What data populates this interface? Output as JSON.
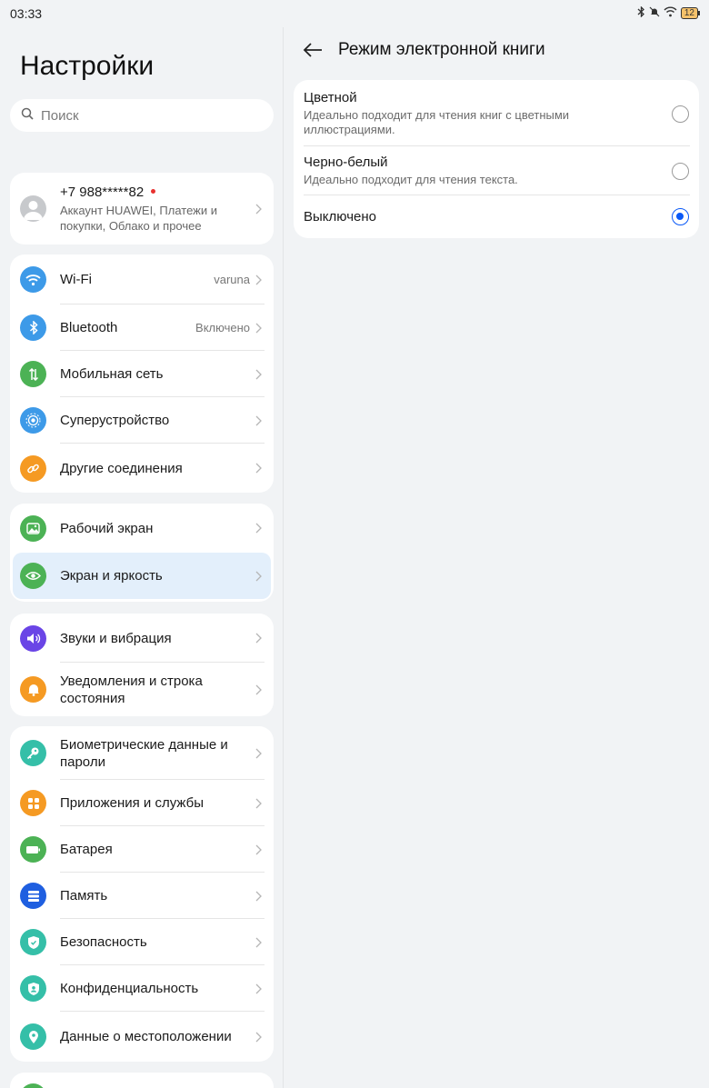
{
  "status_bar": {
    "time": "03:33",
    "battery": "12"
  },
  "left": {
    "title": "Настройки",
    "search_placeholder": "Поиск",
    "account": {
      "name": "+7 988*****82",
      "subtitle_line1": "Аккаунт HUAWEI, Платежи и",
      "subtitle_line2": "покупки, Облако и прочее"
    },
    "group1": [
      {
        "label": "Wi-Fi",
        "value": "varuna",
        "icon": "wifi-icon",
        "color": "#3d9ae8"
      },
      {
        "label": "Bluetooth",
        "value": "Включено",
        "icon": "bluetooth-icon",
        "color": "#3d9ae8"
      },
      {
        "label": "Мобильная сеть",
        "value": "",
        "icon": "mobile-network-icon",
        "color": "#4cb255"
      },
      {
        "label": "Суперустройство",
        "value": "",
        "icon": "super-device-icon",
        "color": "#3d9ae8"
      },
      {
        "label": "Другие соединения",
        "value": "",
        "icon": "link-icon",
        "color": "#f59a23"
      }
    ],
    "group2": [
      {
        "label": "Рабочий экран",
        "icon": "home-screen-icon",
        "color": "#4cb255"
      },
      {
        "label": "Экран и яркость",
        "icon": "eye-icon",
        "color": "#4cb255"
      }
    ],
    "group3": [
      {
        "label": "Звуки и вибрация",
        "icon": "speaker-icon",
        "color": "#6a45e6"
      },
      {
        "label_line1": "Уведомления и строка",
        "label_line2": "состояния",
        "icon": "bell-icon",
        "color": "#f59a23"
      }
    ],
    "group4": [
      {
        "label_line1": "Биометрические данные и",
        "label_line2": "пароли",
        "icon": "key-icon",
        "color": "#35bfa8"
      },
      {
        "label": "Приложения и службы",
        "icon": "apps-icon",
        "color": "#f59a23"
      },
      {
        "label": "Батарея",
        "icon": "battery-icon",
        "color": "#4cb255"
      },
      {
        "label": "Память",
        "icon": "storage-icon",
        "color": "#1f5fe0"
      },
      {
        "label": "Безопасность",
        "icon": "shield-icon",
        "color": "#35bfa8"
      },
      {
        "label": "Конфиденциальность",
        "icon": "privacy-icon",
        "color": "#35bfa8"
      },
      {
        "label": "Данные о местоположении",
        "icon": "location-icon",
        "color": "#35bfa8"
      }
    ]
  },
  "right": {
    "title": "Режим электронной книги",
    "options": [
      {
        "title": "Цветной",
        "desc": "Идеально подходит для чтения книг с цветными иллюстрациями.",
        "selected": false
      },
      {
        "title": "Черно-белый",
        "desc": "Идеально подходит для чтения текста.",
        "selected": false
      },
      {
        "title": "Выключено",
        "desc": "",
        "selected": true
      }
    ]
  },
  "colors": {
    "accent": "#0a59f7",
    "active_row": "#e3effb",
    "background": "#f1f3f5"
  }
}
